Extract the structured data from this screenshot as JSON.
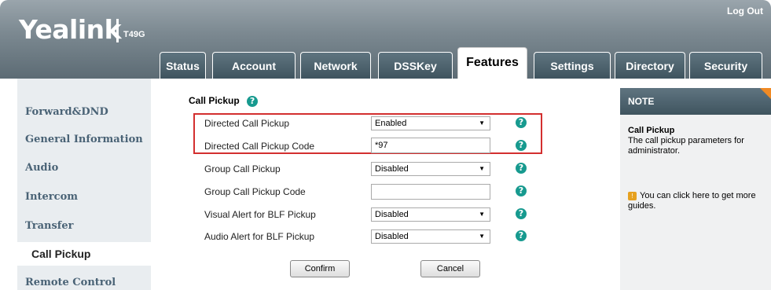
{
  "header": {
    "brand": "Yealink",
    "model": "T49G",
    "logout_label": "Log Out"
  },
  "tabs": [
    {
      "label": "Status"
    },
    {
      "label": "Account"
    },
    {
      "label": "Network"
    },
    {
      "label": "DSSKey"
    },
    {
      "label": "Features",
      "active": true
    },
    {
      "label": "Settings"
    },
    {
      "label": "Directory"
    },
    {
      "label": "Security"
    }
  ],
  "sidebar": {
    "items": [
      {
        "label": "Forward&DND"
      },
      {
        "label": "General Information"
      },
      {
        "label": "Audio"
      },
      {
        "label": "Intercom"
      },
      {
        "label": "Transfer"
      },
      {
        "label": "Call Pickup",
        "active": true
      },
      {
        "label": "Remote Control"
      }
    ]
  },
  "main": {
    "section_title": "Call Pickup",
    "help_glyph": "?",
    "rows": [
      {
        "label": "Directed Call Pickup",
        "type": "select",
        "value": "Enabled"
      },
      {
        "label": "Directed Call Pickup Code",
        "type": "input",
        "value": "*97"
      },
      {
        "label": "Group Call Pickup",
        "type": "select",
        "value": "Disabled"
      },
      {
        "label": "Group Call Pickup Code",
        "type": "input",
        "value": ""
      },
      {
        "label": "Visual Alert for BLF Pickup",
        "type": "select",
        "value": "Disabled"
      },
      {
        "label": "Audio Alert for BLF Pickup",
        "type": "select",
        "value": "Disabled"
      }
    ],
    "confirm_label": "Confirm",
    "cancel_label": "Cancel"
  },
  "note": {
    "title": "NOTE",
    "subtitle": "Call Pickup",
    "text": "The call pickup parameters for administrator.",
    "guide_text": "You can click here to get more guides."
  },
  "colors": {
    "highlight": "#d32f2f",
    "help_icon": "#179a8f",
    "tab_bg": "#4a5f6b",
    "note_corner": "#f08a24"
  }
}
